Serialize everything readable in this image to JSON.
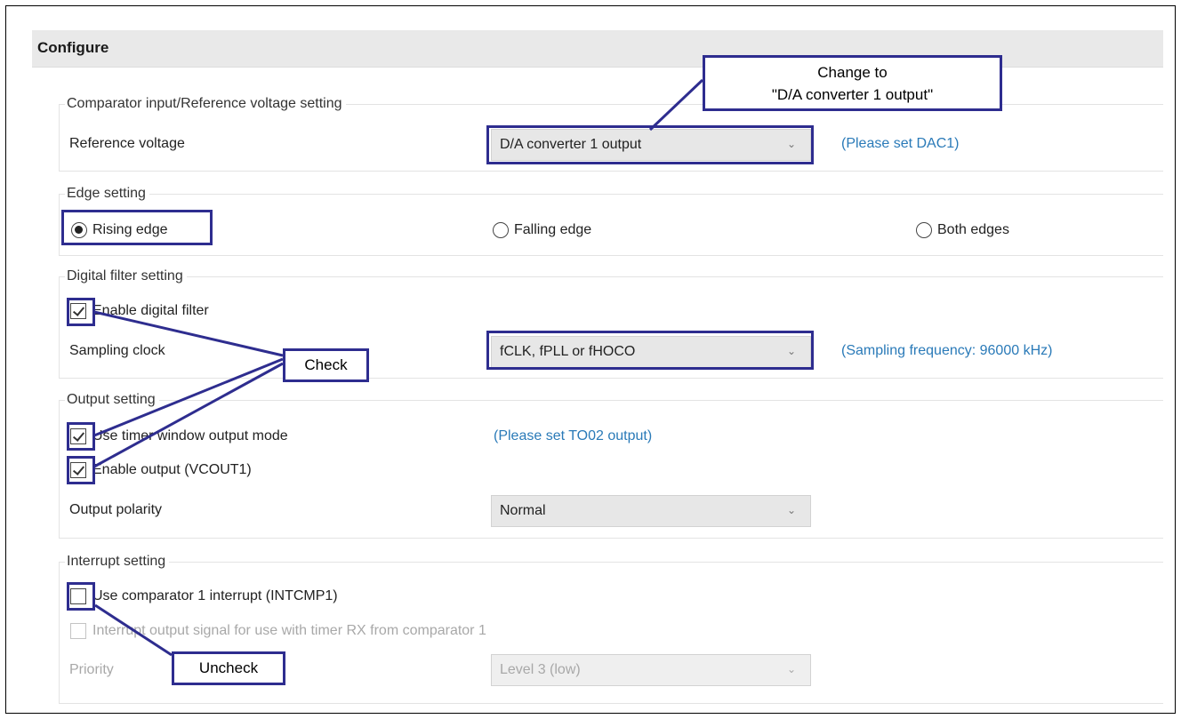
{
  "header": {
    "title": "Configure"
  },
  "comparator": {
    "title": "Comparator input/Reference voltage setting",
    "ref_label": "Reference voltage",
    "ref_value": "D/A converter 1 output",
    "ref_hint": "(Please set DAC1)"
  },
  "edge": {
    "title": "Edge setting",
    "options": [
      "Rising edge",
      "Falling edge",
      "Both edges"
    ],
    "selected": "Rising edge"
  },
  "filter": {
    "title": "Digital filter setting",
    "enable_label": "Enable digital filter",
    "enable_checked": true,
    "clock_label": "Sampling clock",
    "clock_value": "fCLK, fPLL or fHOCO",
    "clock_hint": "(Sampling frequency: 96000 kHz)"
  },
  "output": {
    "title": "Output setting",
    "timer_label": "Use timer window output mode",
    "timer_checked": true,
    "timer_hint": "(Please set TO02 output)",
    "enable_label": "Enable output (VCOUT1)",
    "enable_checked": true,
    "polarity_label": "Output polarity",
    "polarity_value": "Normal"
  },
  "interrupt": {
    "title": "Interrupt setting",
    "use_label": "Use comparator 1 interrupt (INTCMP1)",
    "use_checked": false,
    "signal_label": "Interrupt output signal for use with timer RX from comparator 1",
    "signal_checked": false,
    "priority_label": "Priority",
    "priority_value": "Level 3 (low)"
  },
  "annotations": {
    "change_to_line1": "Change to",
    "change_to_line2": "\"D/A converter 1 output\"",
    "check": "Check",
    "uncheck": "Uncheck",
    "accent_color": "#2e2d8f"
  }
}
